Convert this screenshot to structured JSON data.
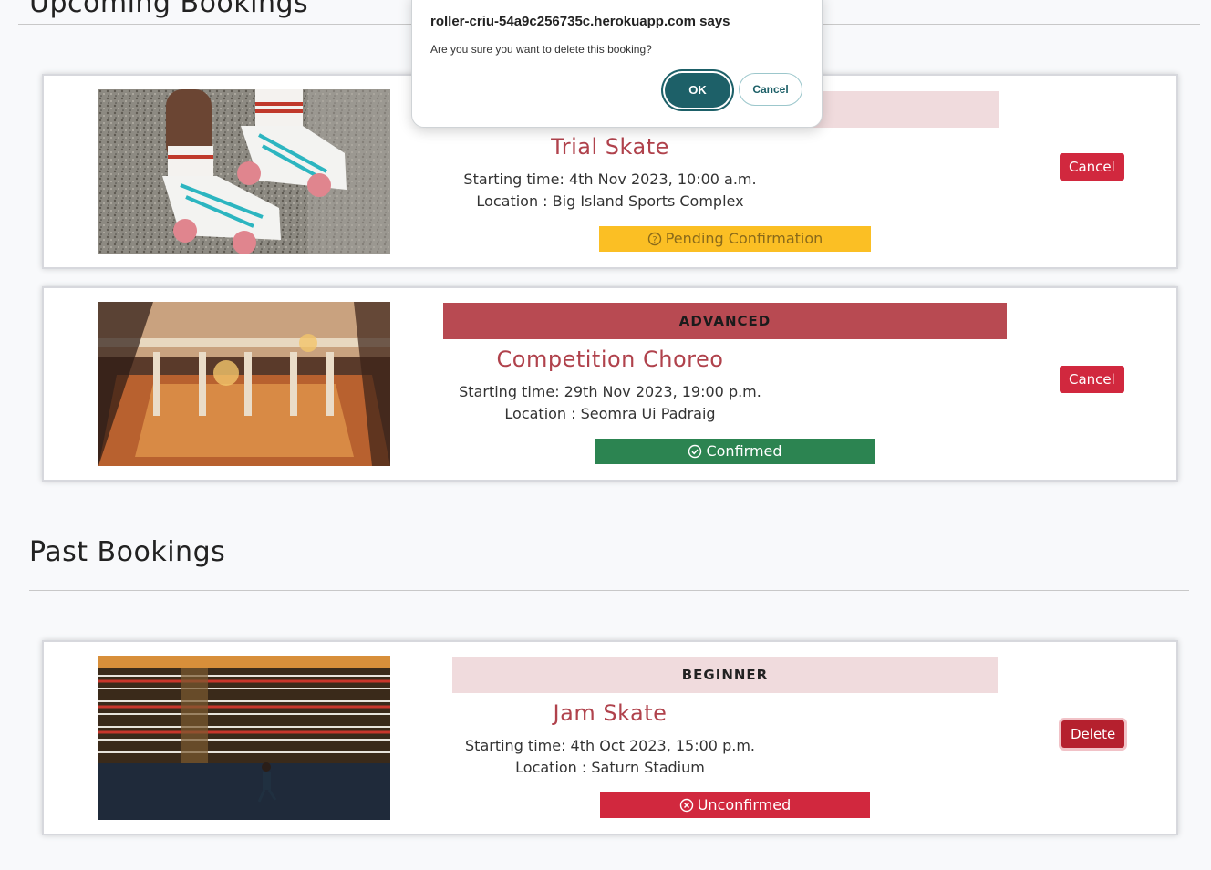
{
  "sections": {
    "upcoming_title": "Upcoming Bookings",
    "past_title": "Past Bookings"
  },
  "bookings": [
    {
      "level": "",
      "title": "Trial Skate",
      "time": "Starting time: 4th Nov 2023, 10:00 a.m.",
      "location": "Location : Big Island Sports Complex",
      "status": "Pending Confirmation",
      "status_icon": "question-circle-icon",
      "action": "Cancel",
      "image": "roller-skates-photo"
    },
    {
      "level": "ADVANCED",
      "title": "Competition Choreo",
      "time": "Starting time: 29th Nov 2023, 19:00 p.m.",
      "location": "Location : Seomra Ui Padraig",
      "status": "Confirmed",
      "status_icon": "check-circle-icon",
      "action": "Cancel",
      "image": "ballroom-hall-photo"
    },
    {
      "level": "BEGINNER",
      "title": "Jam Skate",
      "time": "Starting time: 4th Oct 2023, 15:00 p.m.",
      "location": "Location : Saturn Stadium",
      "status": "Unconfirmed",
      "status_icon": "x-circle-icon",
      "action": "Delete",
      "image": "stadium-skater-photo"
    }
  ],
  "dialog": {
    "title": "roller-criu-54a9c256735c.herokuapp.com says",
    "message": "Are you sure you want to delete this booking?",
    "ok": "OK",
    "cancel": "Cancel"
  },
  "colors": {
    "accent_red": "#d1283e",
    "title_red": "#b0424c",
    "confirmed_green": "#2c8451",
    "pending_yellow": "#fbbf24",
    "dialog_teal": "#1d6068"
  }
}
